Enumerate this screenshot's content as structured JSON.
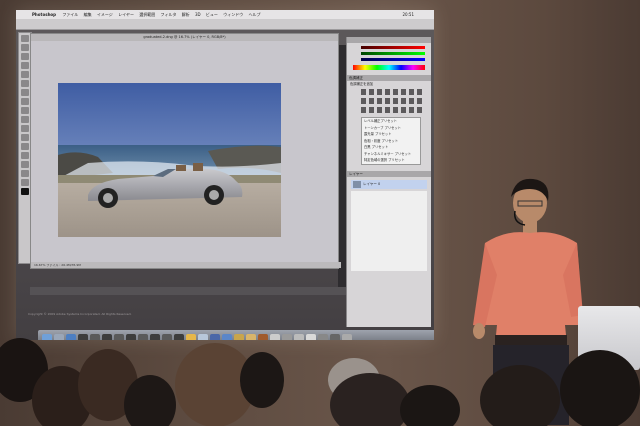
{
  "scene": {
    "description_text": ""
  },
  "projection": {
    "menubar": {
      "app_name": "Photoshop",
      "menus": [
        "ファイル",
        "編集",
        "イメージ",
        "レイヤー",
        "選択範囲",
        "フィルタ",
        "解析",
        "3D",
        "ビュー",
        "ウィンドウ",
        "ヘルプ"
      ],
      "clock": "20:51"
    },
    "document": {
      "title": "graduated-2.dng @ 16.7% (レイヤー 0, RGB/8*)",
      "status": "16.67%   ファイル : 26.4M/35.9M"
    },
    "panels": {
      "adjustments_title": "色調補正",
      "adjustments_subtitle": "色調補正を追加",
      "presets": [
        "レベル補正プリセット",
        "トーンカーブ プリセット",
        "露光量 プリセット",
        "色相・彩度 プリセット",
        "白黒 プリセット",
        "チャンネルミキサー プリセット",
        "特定色域の選択 プリセット"
      ],
      "layers_title": "レイヤー",
      "layer_name": "レイヤー 0"
    },
    "copyright": "Copyright © 2009 Adobe Systems Incorporated. All Rights Reserved."
  },
  "colors": {
    "wall": "#5d4b40",
    "shirt": "#e8836b",
    "sky": "#5b78b8",
    "car": "#a9a9ad"
  }
}
